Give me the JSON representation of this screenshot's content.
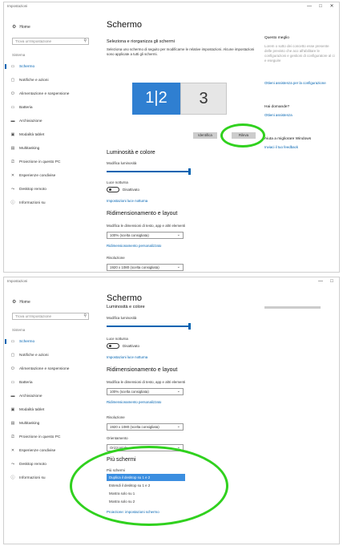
{
  "shot1": {
    "window_title": "Impostazioni",
    "controls": {
      "minimize": "—",
      "maximize": "□",
      "close": "✕"
    },
    "sidebar": {
      "home": "Home",
      "search_placeholder": "Trova un'impostazione",
      "section": "Sistema",
      "items": [
        {
          "label": "Schermo",
          "icon": "monitor-icon"
        },
        {
          "label": "Notifiche e azioni",
          "icon": "notification-icon"
        },
        {
          "label": "Alimentazione e sospensione",
          "icon": "power-icon"
        },
        {
          "label": "Batteria",
          "icon": "battery-icon"
        },
        {
          "label": "Archiviazione",
          "icon": "storage-icon"
        },
        {
          "label": "Modalità tablet",
          "icon": "tablet-icon"
        },
        {
          "label": "Multitasking",
          "icon": "multitasking-icon"
        },
        {
          "label": "Proiezione in questo PC",
          "icon": "projection-icon"
        },
        {
          "label": "Esperienze condivise",
          "icon": "shared-icon"
        },
        {
          "label": "Desktop remoto",
          "icon": "remote-icon"
        },
        {
          "label": "Informazioni su",
          "icon": "info-icon"
        }
      ]
    },
    "main": {
      "title": "Schermo",
      "arrange_heading": "Seleziona e riorganizza gli schermi",
      "arrange_desc": "Seleziona uno schermo di seguito per modificarne le relative impostazioni. Alcune impostazioni sono applicate a tutti gli schermi.",
      "monitor1": "1|2",
      "monitor2": "3",
      "identify_button": "Identifica",
      "detect_button": "Rileva",
      "brightness_heading": "Luminosità e colore",
      "brightness_label": "Modifica luminosità",
      "night_light_label": "Luce notturna",
      "night_light_state": "Disattivato",
      "night_light_link": "Impostazioni luce notturna",
      "scale_heading": "Ridimensionamento e layout",
      "scale_label": "Modifica le dimensioni di testo, app e altri elementi",
      "scale_value": "100% (scelta consigliata)",
      "custom_scale_link": "Ridimensionamento personalizzato",
      "resolution_label": "Risoluzione",
      "resolution_value": "1920 x 1080 (scelta consigliata)"
    },
    "right": {
      "heading1": "Questo meglio",
      "body1": "Lorem o sotto dei concetto esse presente delle previsto che aco all'abilitare le configurazioni e gestioni di configuratore al ci e eseguire",
      "link1": "Ottieni assistenza per la configurazione",
      "heading2": "Hai domande?",
      "link2": "Ottieni assistenza",
      "heading3": "Aiuta a migliorare Windows",
      "link3": "Inviaci il tuo feedback"
    }
  },
  "shot2": {
    "window_title": "Impostazioni",
    "controls": {
      "minimize": "—",
      "maximize": "□"
    },
    "sidebar": {
      "home": "Home",
      "search_placeholder": "Trova un'impostazione",
      "section": "Sistema",
      "items": [
        {
          "label": "Schermo",
          "icon": "monitor-icon"
        },
        {
          "label": "Notifiche e azioni",
          "icon": "notification-icon"
        },
        {
          "label": "Alimentazione e sospensione",
          "icon": "power-icon"
        },
        {
          "label": "Batteria",
          "icon": "battery-icon"
        },
        {
          "label": "Archiviazione",
          "icon": "storage-icon"
        },
        {
          "label": "Modalità tablet",
          "icon": "tablet-icon"
        },
        {
          "label": "Multitasking",
          "icon": "multitasking-icon"
        },
        {
          "label": "Proiezione in questo PC",
          "icon": "projection-icon"
        },
        {
          "label": "Esperienze condivise",
          "icon": "shared-icon"
        },
        {
          "label": "Desktop remoto",
          "icon": "remote-icon"
        },
        {
          "label": "Informazioni su",
          "icon": "info-icon"
        }
      ]
    },
    "main": {
      "title": "Schermo",
      "brightness_heading": "Luminosità e colore",
      "brightness_label": "Modifica luminosità",
      "night_light_label": "Luce notturna",
      "night_light_state": "Disattivato",
      "night_light_link": "Impostazioni luce notturna",
      "scale_heading": "Ridimensionamento e layout",
      "scale_label": "Modifica le dimensioni di testo, app e altri elementi",
      "scale_value": "100% (scelta consigliata)",
      "custom_scale_link": "Ridimensionamento personalizzato",
      "resolution_label": "Risoluzione",
      "resolution_value": "1920 x 1080 (scelta consigliata)",
      "orientation_label": "Orientamento",
      "orientation_value": "Orizzontale",
      "multi_heading": "Più schermi",
      "multi_label": "Più schermi",
      "multi_options": [
        "Duplica il desktop su 1 e 2",
        "Estendi il desktop su 1 e 2",
        "Mostra solo su 1",
        "Mostra solo su 2"
      ],
      "multi_selected_index": 0,
      "advanced_link": "Proiezione: impostazioni schermo"
    }
  },
  "colors": {
    "accent": "#0063b1",
    "highlight": "#30d11e",
    "selected": "#3b8ee0",
    "monitor_active": "#2f7fd1"
  }
}
